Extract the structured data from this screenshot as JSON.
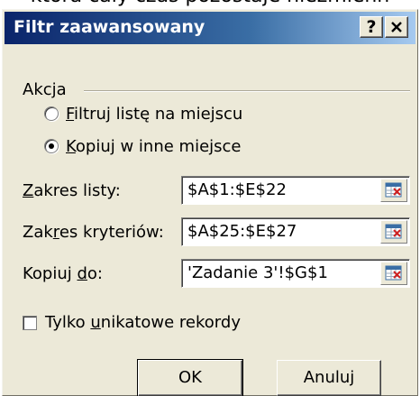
{
  "background_text": "która cały czas pozostaje niezmienn",
  "dialog": {
    "title": "Filtr zaawansowany",
    "help_label": "?",
    "close_label": "✕"
  },
  "action_group": {
    "label": "Akcja",
    "options": [
      {
        "pre": "",
        "accel": "F",
        "post": "iltruj listę na miejscu",
        "checked": false
      },
      {
        "pre": "",
        "accel": "K",
        "post": "opiuj w inne miejsce",
        "checked": true
      }
    ]
  },
  "fields": [
    {
      "label_pre": "",
      "label_accel": "Z",
      "label_post": "akres listy:",
      "value": "$A$1:$E$22"
    },
    {
      "label_pre": "Zak",
      "label_accel": "r",
      "label_post": "es kryteriów:",
      "value": "$A$25:$E$27"
    },
    {
      "label_pre": "Kopiuj ",
      "label_accel": "d",
      "label_post": "o:",
      "value": "'Zadanie 3'!$G$1"
    }
  ],
  "unique_checkbox": {
    "pre": "Tylko ",
    "accel": "u",
    "post": "nikatowe rekordy",
    "checked": false
  },
  "buttons": {
    "ok": "OK",
    "cancel": "Anuluj"
  },
  "icons": {
    "ref_button": "collapse-dialog-icon"
  }
}
